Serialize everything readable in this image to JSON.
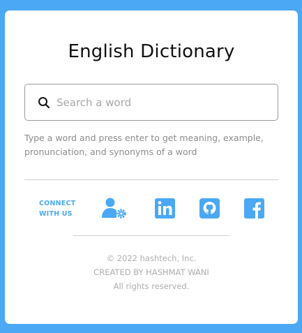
{
  "app": {
    "title": "English Dictionary"
  },
  "search": {
    "placeholder": "Search a word",
    "value": "",
    "icon": "search-icon"
  },
  "hint": {
    "text": "Type a word and press enter to get meaning, example, pronunciation, and synonyms of a word"
  },
  "connect": {
    "line1": "CONNECT",
    "line2": "WITH US"
  },
  "social": [
    {
      "name": "profile-settings-icon"
    },
    {
      "name": "linkedin-icon",
      "glyph": "in"
    },
    {
      "name": "github-icon"
    },
    {
      "name": "facebook-icon",
      "glyph": "f"
    }
  ],
  "footer": {
    "copyright": "© 2022 hashtech, Inc.",
    "credit": "CREATED BY HASHMAT WANI",
    "rights": "All rights reserved."
  },
  "colors": {
    "background": "#4aa8f5",
    "accent": "#4aa8f5",
    "card": "#ffffff",
    "text_muted": "#8c8c8c"
  }
}
